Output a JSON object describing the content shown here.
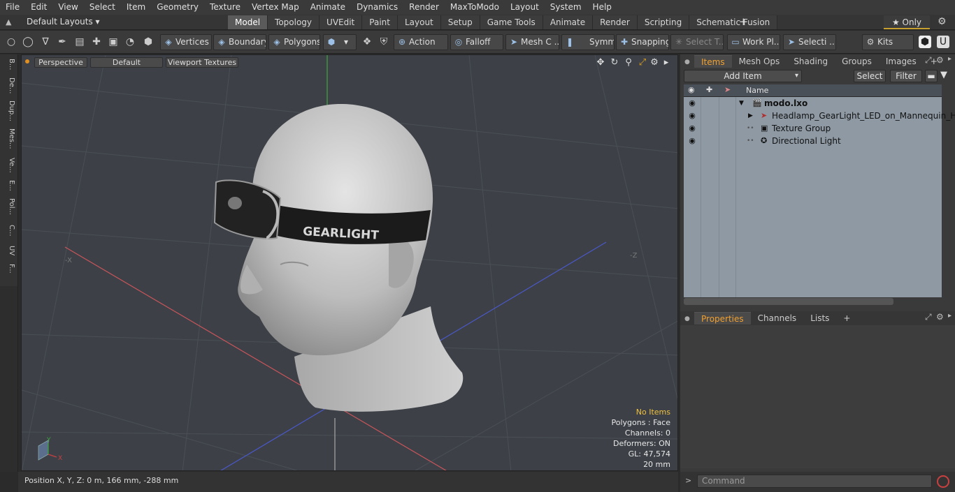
{
  "menu": [
    "File",
    "Edit",
    "View",
    "Select",
    "Item",
    "Geometry",
    "Texture",
    "Vertex Map",
    "Animate",
    "Dynamics",
    "Render",
    "MaxToModo",
    "Layout",
    "System",
    "Help"
  ],
  "layout": {
    "name": "Default Layouts ▾",
    "tabs": [
      "Model",
      "Topology",
      "UVEdit",
      "Paint",
      "Layout",
      "Setup",
      "Game Tools",
      "Animate",
      "Render",
      "Scripting",
      "Schematic Fusion"
    ],
    "active_tab": "Model",
    "plus": "+",
    "only_label": "★ Only"
  },
  "toolbar": {
    "vertices": "Vertices",
    "boundary": "Boundary",
    "polygons": "Polygons",
    "action": "Action",
    "falloff": "Falloff",
    "mesh": "Mesh C ...",
    "symmetry": "Symm ...",
    "snapping": "Snapping",
    "select_t": "Select T...",
    "work_plane": "Work Pl...",
    "selection": "Selecti ...",
    "kits": "Kits"
  },
  "left_tabs": [
    "B...",
    "De...",
    "Dup...",
    "Mes...",
    "Ve...",
    "E...",
    "Pol...",
    "C...",
    "UV",
    "F..."
  ],
  "viewport": {
    "mode": "Perspective",
    "style": "Default",
    "textures": "Viewport Textures",
    "band_text": "GEARLIGHT",
    "axis_x_neg": "-X",
    "axis_z_neg": "-Z",
    "gizmo_y": "Y",
    "gizmo_x": "X",
    "info": {
      "selection": "No Items",
      "polygons": "Polygons : Face",
      "channels": "Channels: 0",
      "deformers": "Deformers: ON",
      "gl": "GL: 47,574",
      "scale": "20 mm"
    }
  },
  "status": {
    "position": "Position X, Y, Z:   0 m, 166 mm, -288 mm"
  },
  "items_panel": {
    "tabs": [
      "Items",
      "Mesh Ops",
      "Shading",
      "Groups",
      "Images"
    ],
    "active_tab": "Items",
    "add_item": "Add Item",
    "select": "Select",
    "filter": "Filter",
    "name_header": "Name",
    "rows": [
      {
        "label": "modo.lxo",
        "indent": 0
      },
      {
        "label": "Headlamp_GearLight_LED_on_Mannequin_Hea ...",
        "indent": 1
      },
      {
        "label": "Texture Group",
        "indent": 1
      },
      {
        "label": "Directional Light",
        "indent": 1
      }
    ]
  },
  "properties_panel": {
    "tabs": [
      "Properties",
      "Channels",
      "Lists"
    ],
    "active_tab": "Properties"
  },
  "command": {
    "placeholder": "Command"
  },
  "colors": {
    "accent": "#f0a030",
    "viewport_bg": "#3d4147",
    "list_bg": "#8e99a3",
    "warning": "#f0c040"
  }
}
